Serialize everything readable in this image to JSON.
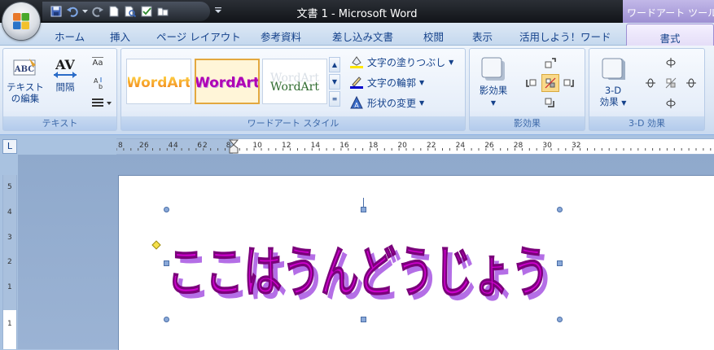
{
  "titlebar": {
    "title": "文書 1 - Microsoft Word",
    "contextual_title": "ワードアート ツール",
    "quick_access": [
      "save-icon",
      "undo-icon",
      "redo-icon",
      "new-document-icon",
      "print-preview-icon",
      "spelling-icon",
      "open-icon"
    ]
  },
  "tabs": [
    {
      "label": "ホーム"
    },
    {
      "label": "挿入"
    },
    {
      "label": "ページ レイアウト"
    },
    {
      "label": "参考資料"
    },
    {
      "label": "差し込み文書"
    },
    {
      "label": "校閲"
    },
    {
      "label": "表示"
    },
    {
      "label": "活用しよう！ワード"
    }
  ],
  "active_tab": "書式",
  "ribbon": {
    "text_group": {
      "label": "テキスト",
      "edit_text_line1": "テキスト",
      "edit_text_line2": "の編集",
      "spacing": "間隔",
      "spacing_sample": "AV",
      "edit_sample": "ABC"
    },
    "wordart_styles_group": {
      "label": "ワードアート スタイル",
      "samples": [
        "WordArt",
        "WordArt",
        "WordArt"
      ],
      "fill": "文字の塗りつぶし",
      "outline": "文字の輪郭",
      "change_shape": "形状の変更"
    },
    "shadow_group": {
      "label": "影効果",
      "shadow_effect": "影効果"
    },
    "threed_group": {
      "label": "3-D 効果",
      "threed_line1": "3-D",
      "threed_line2": "効果"
    }
  },
  "ruler": {
    "corner": "L",
    "h_left": [
      "8",
      "6",
      "4",
      "2"
    ],
    "h_right": [
      "2",
      "4",
      "6",
      "8",
      "10",
      "12",
      "14",
      "16",
      "18",
      "20",
      "22",
      "24",
      "26",
      "28",
      "30",
      "32"
    ],
    "v_labels": [
      "5",
      "4",
      "3",
      "2",
      "1",
      "1"
    ]
  },
  "document": {
    "wordart_text": "ここはうんどうじょう"
  },
  "colors": {
    "wordart_fill": "#cc00cc",
    "wordart_shadow": "#b46ee6",
    "ribbon_text": "#15428b",
    "contextual_tab": "#9d8fd3"
  }
}
